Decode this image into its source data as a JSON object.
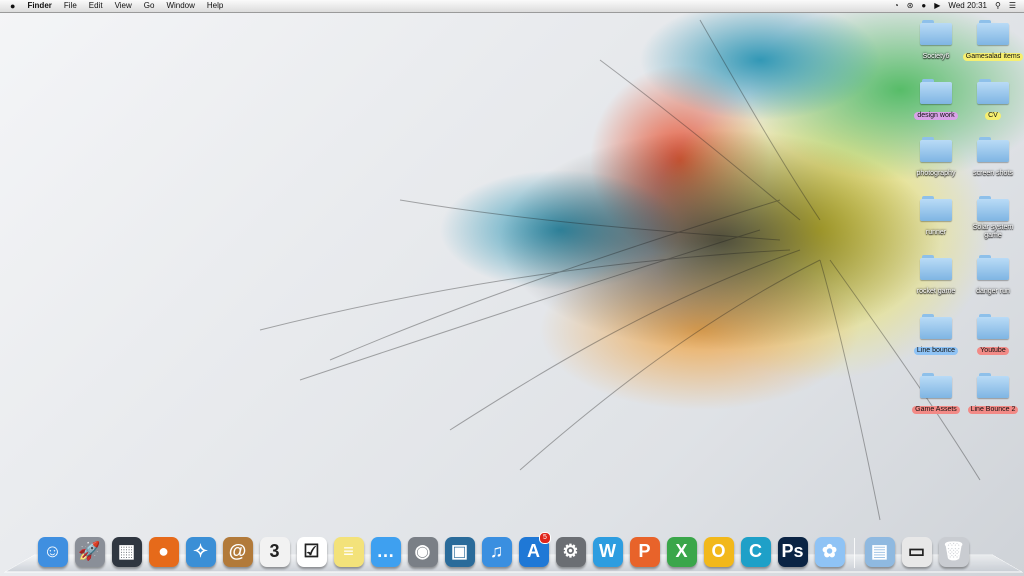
{
  "menubar": {
    "apple": "",
    "app_name": "Finder",
    "menus": [
      "File",
      "Edit",
      "View",
      "Go",
      "Window",
      "Help"
    ],
    "clock": "Wed 20:31",
    "status_icons": [
      "time-machine-icon",
      "bluetooth-icon",
      "wifi-icon",
      "volume-icon"
    ]
  },
  "desktop": {
    "icons": [
      {
        "label": "Society6",
        "tag": ""
      },
      {
        "label": "Gamesalad items",
        "tag": "yellow"
      },
      {
        "label": "design work",
        "tag": "purple"
      },
      {
        "label": "CV",
        "tag": "yellow"
      },
      {
        "label": "photography",
        "tag": ""
      },
      {
        "label": "screen shots",
        "tag": ""
      },
      {
        "label": "runner",
        "tag": ""
      },
      {
        "label": "Solar system game",
        "tag": ""
      },
      {
        "label": "rocket game",
        "tag": ""
      },
      {
        "label": "danger run",
        "tag": ""
      },
      {
        "label": "Line bounce",
        "tag": "blue"
      },
      {
        "label": "Youtube",
        "tag": "red"
      },
      {
        "label": "Game Assets",
        "tag": "red"
      },
      {
        "label": "Line Bounce 2",
        "tag": "red"
      }
    ]
  },
  "dock": {
    "apps": [
      {
        "name": "finder-icon",
        "glyph": "☺",
        "color": "#3f8fe0"
      },
      {
        "name": "launchpad-icon",
        "glyph": "🚀",
        "color": "#8a8f98"
      },
      {
        "name": "mission-control-icon",
        "glyph": "▦",
        "color": "#2f3640"
      },
      {
        "name": "firefox-icon",
        "glyph": "●",
        "color": "#e66a1a"
      },
      {
        "name": "safari-icon",
        "glyph": "✧",
        "color": "#3b8fd6"
      },
      {
        "name": "address-book-icon",
        "glyph": "@",
        "color": "#b27a3a"
      },
      {
        "name": "calendar-icon",
        "glyph": "3",
        "color": "#f2f2f2"
      },
      {
        "name": "reminders-icon",
        "glyph": "☑",
        "color": "#ffffff"
      },
      {
        "name": "notes-icon",
        "glyph": "≡",
        "color": "#f3e27a"
      },
      {
        "name": "messages-icon",
        "glyph": "…",
        "color": "#3ea0f0"
      },
      {
        "name": "facetime-icon",
        "glyph": "◉",
        "color": "#7a7f86"
      },
      {
        "name": "iphoto-icon",
        "glyph": "▣",
        "color": "#2a6b9a"
      },
      {
        "name": "itunes-icon",
        "glyph": "♫",
        "color": "#3a8fe0"
      },
      {
        "name": "app-store-icon",
        "glyph": "A",
        "color": "#1f78d6"
      },
      {
        "name": "system-preferences-icon",
        "glyph": "⚙",
        "color": "#6b6e73"
      },
      {
        "name": "word-icon",
        "glyph": "W",
        "color": "#2d9de0"
      },
      {
        "name": "powerpoint-icon",
        "glyph": "P",
        "color": "#e8632a"
      },
      {
        "name": "excel-icon",
        "glyph": "X",
        "color": "#3aa64a"
      },
      {
        "name": "outlook-icon",
        "glyph": "O",
        "color": "#f2b81a"
      },
      {
        "name": "communicator-icon",
        "glyph": "C",
        "color": "#1ea0c8"
      },
      {
        "name": "photoshop-icon",
        "glyph": "Ps",
        "color": "#0b2444"
      },
      {
        "name": "gamesalad-icon",
        "glyph": "✿",
        "color": "#8fc3f5"
      }
    ],
    "app_store_badge": "5",
    "right_items": [
      {
        "name": "downloads-folder-icon",
        "glyph": "▤",
        "color": "#8fb9e0"
      },
      {
        "name": "preview-stack-icon",
        "glyph": "▭",
        "color": "#e8e8e8"
      },
      {
        "name": "trash-icon",
        "glyph": "🗑",
        "color": "#c9ccd1"
      }
    ]
  }
}
